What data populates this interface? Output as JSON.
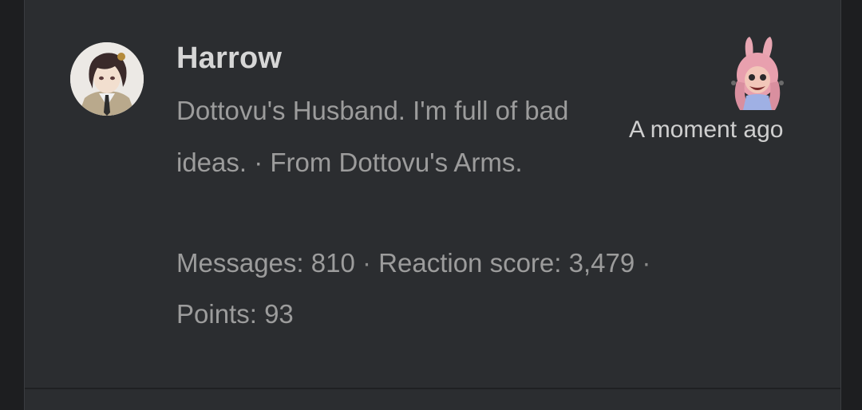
{
  "post": {
    "username": "Harrow",
    "bio": "Dottovu's Husband. I'm full of bad ideas. · From Dottovu's Arms.",
    "stats": {
      "messages_label": "Messages:",
      "messages_value": "810",
      "reaction_label": "Reaction score:",
      "reaction_value": "3,479",
      "points_label": "Points:",
      "points_value": "93",
      "separator": "·"
    },
    "timestamp": "A moment ago"
  },
  "icons": {
    "avatar": "avatar-icon",
    "reaction": "reaction-emote-icon"
  },
  "colors": {
    "background": "#2b2d30",
    "outer_background": "#1d1e20",
    "username": "#d6d6d6",
    "muted_text": "#9c9c9c",
    "timestamp": "#cfcfcf"
  }
}
